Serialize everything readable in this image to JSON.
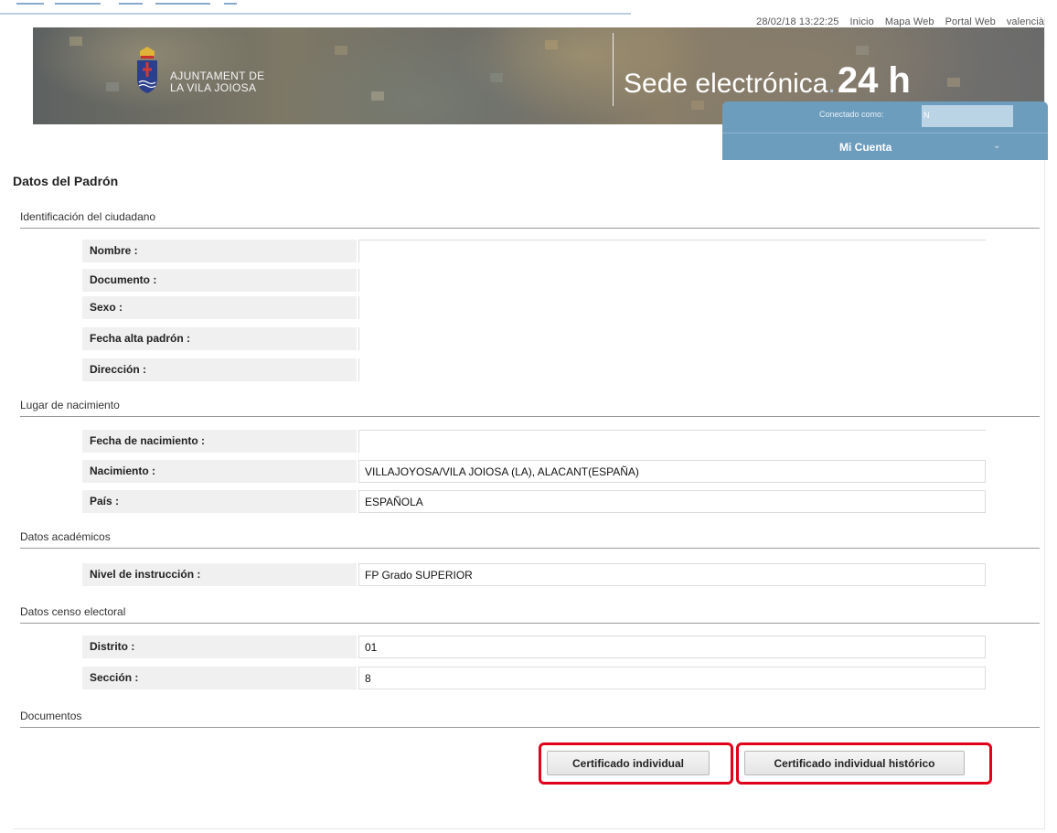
{
  "toplinks": {
    "datetime": "28/02/18 13:22:25",
    "inicio": "Inicio",
    "mapa_web": "Mapa Web",
    "portal_web": "Portal Web",
    "idioma": "valencià"
  },
  "header": {
    "logo_line1": "AJUNTAMENT DE",
    "logo_line2": "LA VILA JOIOSA",
    "sede_text": "Sede electrónica",
    "sede_dot": ".",
    "sede_24h": "24 h"
  },
  "account": {
    "connected_label": "Conectado como:",
    "user_initial": "N",
    "menu_label": "Mi Cuenta"
  },
  "page_title": "Datos del Padrón",
  "sections": {
    "identificacion": {
      "title": "Identificación del ciudadano",
      "rows": [
        {
          "label": "Nombre :",
          "value": ""
        },
        {
          "label": "Documento :",
          "value": ""
        },
        {
          "label": "Sexo :",
          "value": ""
        },
        {
          "label": "Fecha alta padrón :",
          "value": ""
        },
        {
          "label": "Dirección :",
          "value": ""
        }
      ]
    },
    "nacimiento": {
      "title": "Lugar de nacimiento",
      "rows": [
        {
          "label": "Fecha de nacimiento :",
          "value": ""
        },
        {
          "label": "Nacimiento :",
          "value": "VILLAJOYOSA/VILA JOIOSA (LA), ALACANT(ESPAÑA)"
        },
        {
          "label": "País :",
          "value": "ESPAÑOLA"
        }
      ]
    },
    "academicos": {
      "title": "Datos académicos",
      "rows": [
        {
          "label": "Nivel de instrucción :",
          "value": "FP Grado SUPERIOR"
        }
      ]
    },
    "censo": {
      "title": "Datos censo electoral",
      "rows": [
        {
          "label": "Distrito :",
          "value": "01"
        },
        {
          "label": "Sección :",
          "value": "8"
        }
      ]
    },
    "documentos": {
      "title": "Documentos"
    }
  },
  "buttons": {
    "certificado_individual": "Certificado individual",
    "certificado_historico": "Certificado individual histórico"
  }
}
